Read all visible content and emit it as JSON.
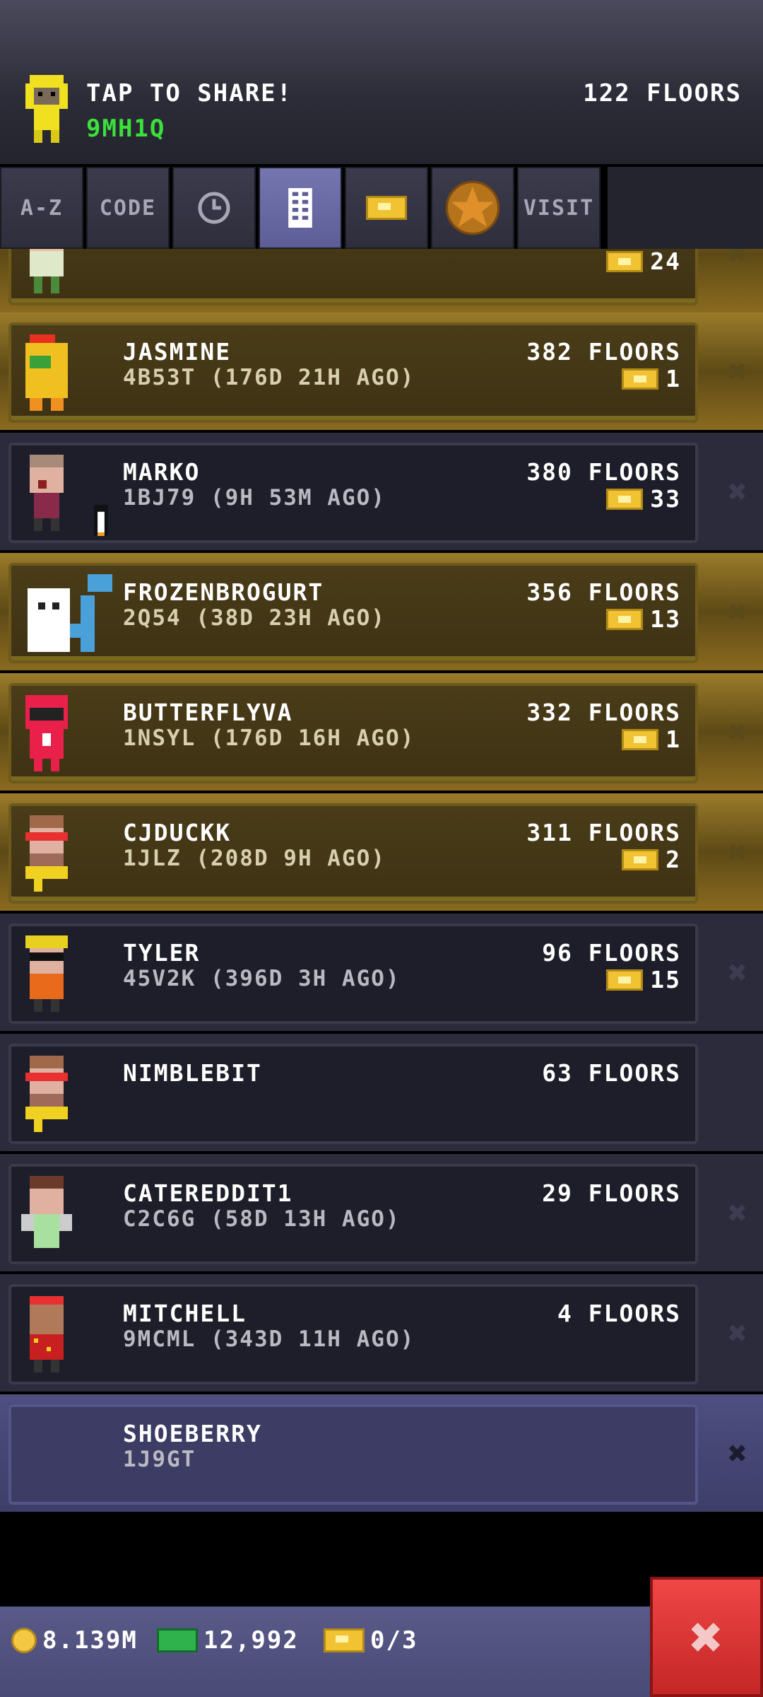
{
  "header": {
    "share_label": "TAP TO SHARE!",
    "player_code": "9MH1Q",
    "floors": "122 FLOORS"
  },
  "tabs": [
    {
      "label": "A-Z",
      "icon": null
    },
    {
      "label": "CODE",
      "icon": null
    },
    {
      "label": "",
      "icon": "clock-icon"
    },
    {
      "label": "",
      "icon": "building-icon"
    },
    {
      "label": "",
      "icon": "ticket-icon"
    },
    {
      "label": "",
      "icon": "star-icon"
    },
    {
      "label": "VISIT",
      "icon": null
    }
  ],
  "friends": [
    {
      "name": "",
      "sub": "",
      "floors": "",
      "tickets": "24",
      "style": "gold",
      "partial": true
    },
    {
      "name": "JASMINE",
      "sub": "4B53T (176D 21H AGO)",
      "floors": "382 FLOORS",
      "tickets": "1",
      "style": "gold"
    },
    {
      "name": "MARKO",
      "sub": "1BJ79 (9H 53M AGO)",
      "floors": "380 FLOORS",
      "tickets": "33",
      "style": "dark"
    },
    {
      "name": "FROZENBROGURT",
      "sub": "2Q54 (38D 23H AGO)",
      "floors": "356 FLOORS",
      "tickets": "13",
      "style": "gold"
    },
    {
      "name": "BUTTERFLYVA",
      "sub": "1NSYL (176D 16H AGO)",
      "floors": "332 FLOORS",
      "tickets": "1",
      "style": "gold"
    },
    {
      "name": "CJDUCKK",
      "sub": "1JLZ (208D 9H AGO)",
      "floors": "311 FLOORS",
      "tickets": "2",
      "style": "gold"
    },
    {
      "name": "TYLER",
      "sub": "45V2K (396D 3H AGO)",
      "floors": "96 FLOORS",
      "tickets": "15",
      "style": "dark"
    },
    {
      "name": "NIMBLEBIT",
      "sub": "",
      "floors": "63 FLOORS",
      "tickets": "",
      "style": "dark"
    },
    {
      "name": "CATEREDDIT1",
      "sub": "C2C6G (58D 13H AGO)",
      "floors": "29 FLOORS",
      "tickets": "",
      "style": "dark"
    },
    {
      "name": "MITCHELL",
      "sub": "9MCML (343D 11H AGO)",
      "floors": "4 FLOORS",
      "tickets": "",
      "style": "dark"
    },
    {
      "name": "SHOEBERRY",
      "sub": "1J9GT",
      "floors": "",
      "tickets": "",
      "style": "blue"
    }
  ],
  "bottom_bar": {
    "coins": "8.139M",
    "bux": "12,992",
    "tickets": "0/3"
  },
  "colors": {
    "code_green": "#3be03b",
    "gold_row": "#9a7b2a",
    "close_red": "#e03a3a"
  }
}
